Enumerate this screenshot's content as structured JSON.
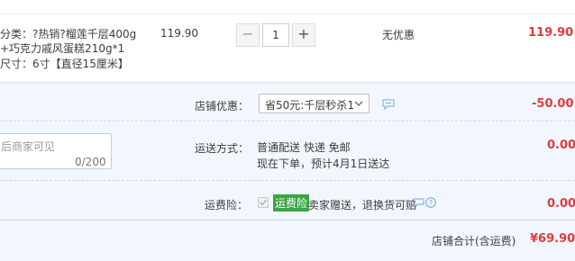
{
  "item": {
    "desc_line1": "分类：?热销?榴莲千层400g",
    "desc_line2": "+巧克力戚风蛋糕210g*1",
    "desc_line3": "尺寸：6寸【直径15厘米】",
    "unit_price": "119.90",
    "qty_minus": "−",
    "qty_value": "1",
    "qty_plus": "+",
    "discount": "无优惠",
    "subtotal": "119.90"
  },
  "shop": {
    "coupon_label": "店铺优惠：",
    "coupon_select": "省50元:千层秒杀1",
    "coupon_amount": "-50.00",
    "message_placeholder": "后商家可见",
    "message_count": "0/200",
    "shipping_label": "运送方式：",
    "shipping_method": "普通配送 快递 免邮",
    "shipping_eta": "现在下单，预计4月1日送达",
    "shipping_amount": "0.00",
    "insurance_label": "运费险：",
    "insurance_badge": "运费险",
    "insurance_text": "卖家赠送，退换货可赔",
    "insurance_amount": "0.00",
    "total_label": "店铺合计(含运费)",
    "total_amount": "¥69.90"
  },
  "colors": {
    "accent_red": "#e4393c",
    "panel_bg": "#f2f7ff",
    "badge_green": "#3aa546",
    "icon_blue": "#6fa8dc"
  }
}
